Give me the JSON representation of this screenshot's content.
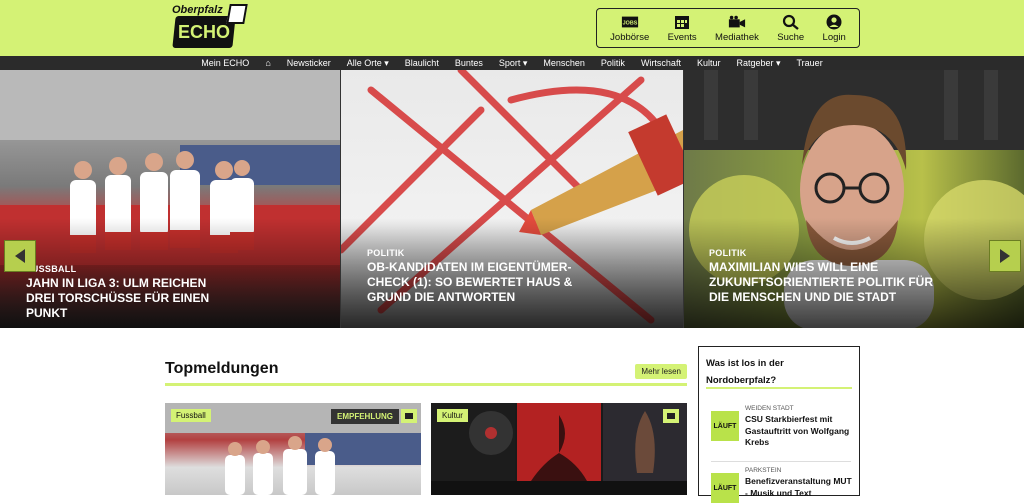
{
  "header": {
    "logo_small": "Oberpfalz",
    "logo_main": "ECHO",
    "topnav": [
      {
        "label": "Jobbörse",
        "icon": "jobs-icon"
      },
      {
        "label": "Events",
        "icon": "calendar-icon"
      },
      {
        "label": "Mediathek",
        "icon": "video-camera-icon"
      },
      {
        "label": "Suche",
        "icon": "search-icon"
      },
      {
        "label": "Login",
        "icon": "user-icon"
      }
    ],
    "jobs_badge": "JOBS"
  },
  "mainnav": {
    "items": [
      "Mein ECHO",
      "⌂",
      "Newsticker",
      "Alle Orte ▾",
      "Blaulicht",
      "Buntes",
      "Sport ▾",
      "Menschen",
      "Politik",
      "Wirtschaft",
      "Kultur",
      "Ratgeber ▾",
      "Trauer"
    ]
  },
  "hero": {
    "slides": [
      {
        "category": "FUSSBALL",
        "title": "Jahn in Liga 3: Ulm reichen drei Torschüsse für einen Punkt"
      },
      {
        "category": "POLITIK",
        "title": "OB-Kandidaten im Eigentümer-Check (1): So bewertet Haus & Grund die Antworten"
      },
      {
        "category": "POLITIK",
        "title": "Maximilian Wies will eine zukunftsorientierte Politik für die Menschen und die Stadt"
      }
    ]
  },
  "topmeldungen": {
    "title": "Topmeldungen",
    "more_label": "Mehr lesen",
    "cards": [
      {
        "tag": "Fussball",
        "badge": "EMPFEHLUNG"
      },
      {
        "tag": "Kultur"
      }
    ]
  },
  "sidebar": {
    "title": "Was ist los in der Nordoberpfalz?",
    "events": [
      {
        "status": "LÄUFT",
        "location": "WEIDEN STADT",
        "title": "CSU Starkbierfest mit Gastauftritt von Wolfgang Krebs"
      },
      {
        "status": "LÄUFT",
        "location": "PARKSTEIN",
        "title": "Benefizveranstaltung MUT - Musik und Text"
      }
    ]
  },
  "colors": {
    "brand_green": "#d4f275",
    "nav_dark": "#2b2b2b"
  }
}
